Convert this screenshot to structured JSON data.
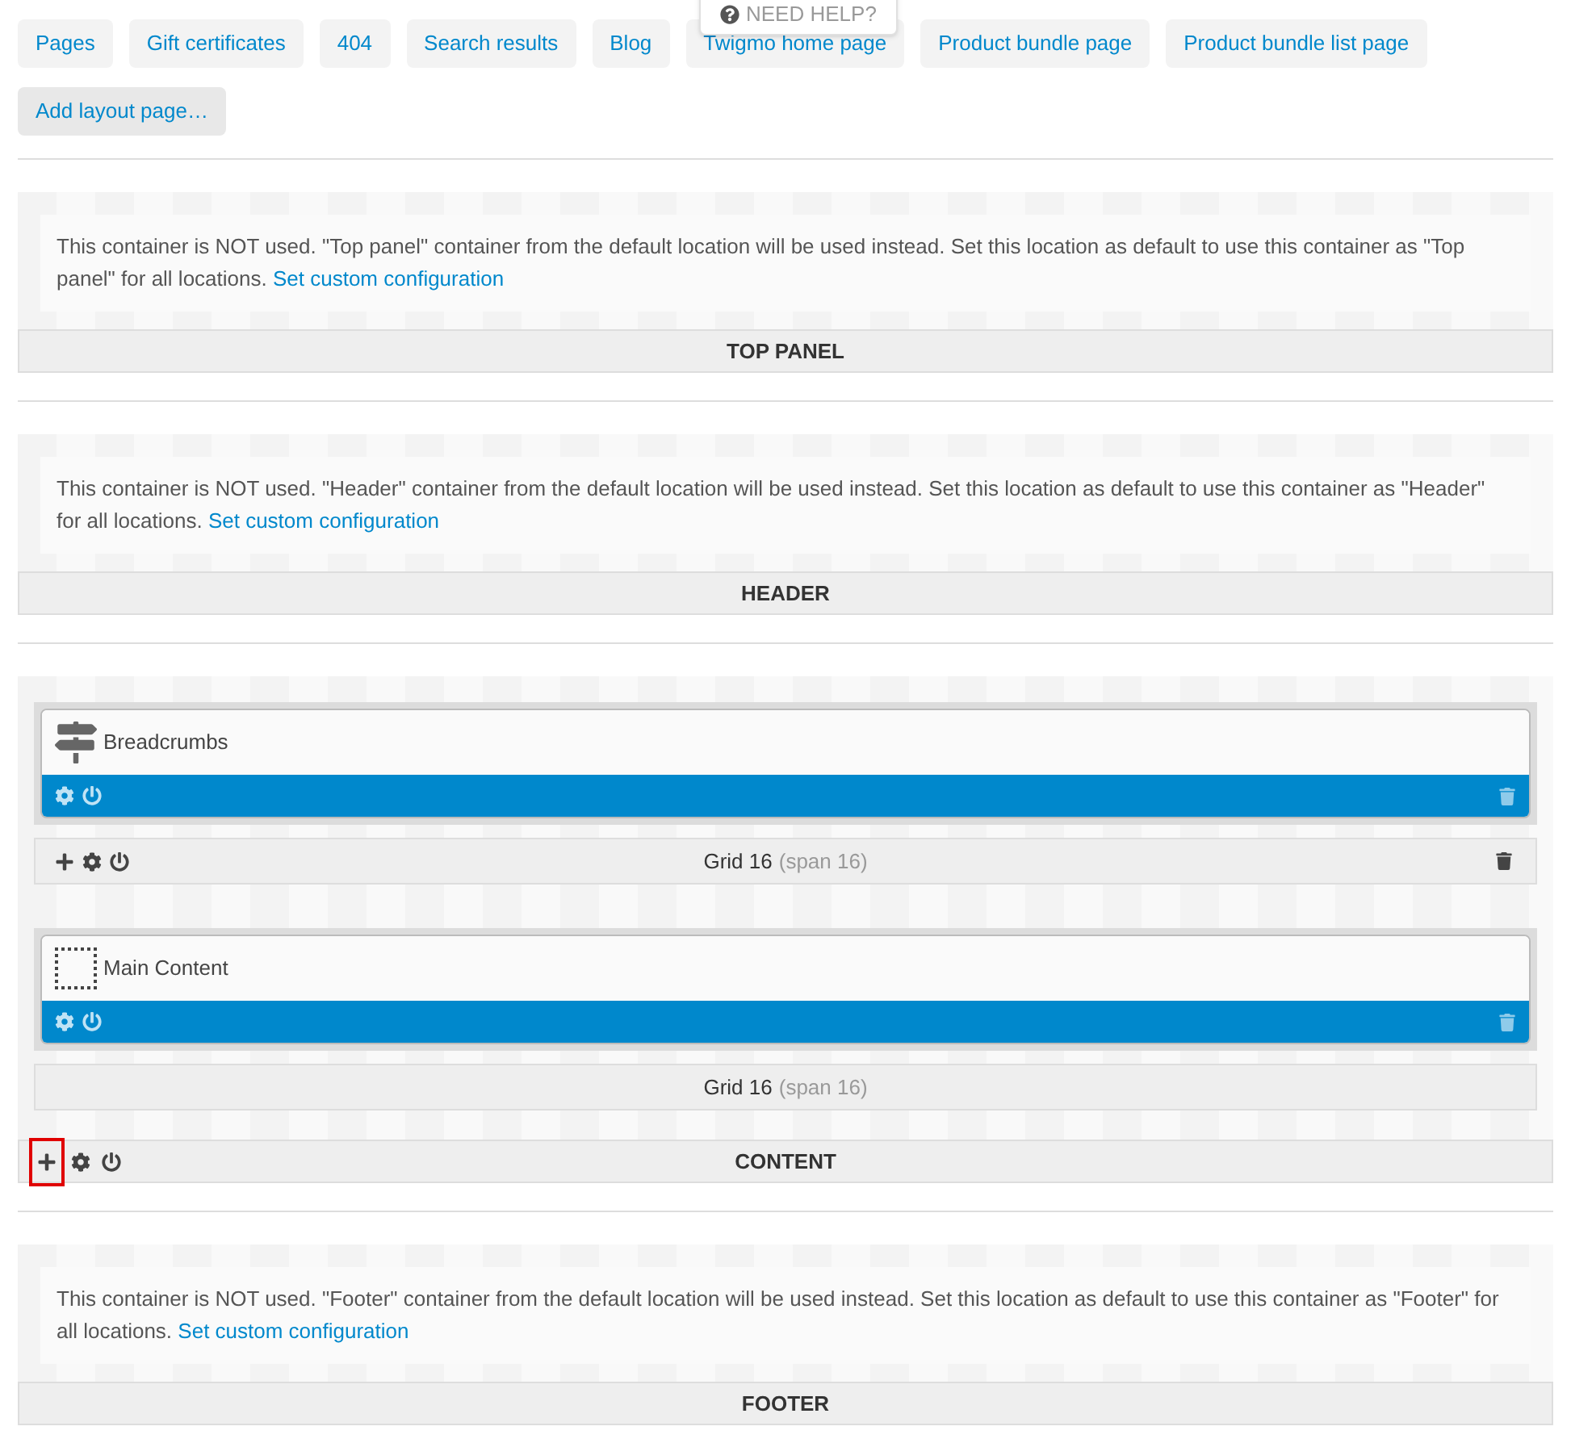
{
  "layout_tabs": [
    {
      "label": "Pages"
    },
    {
      "label": "Gift certificates"
    },
    {
      "label": "404"
    },
    {
      "label": "Search results"
    },
    {
      "label": "Blog"
    },
    {
      "label": "Twigmo home page"
    },
    {
      "label": "Product bundle page"
    },
    {
      "label": "Product bundle list page"
    }
  ],
  "help_tab": {
    "label": "NEED HELP?"
  },
  "add_layout_button": "Add layout page…",
  "containers": [
    {
      "kind": "unused",
      "notice": "This container is NOT used. \"Top panel\" container from the default location will be used instead. Set this location as default to use this container as \"Top panel\" for all locations.",
      "link": "Set custom configuration",
      "title": "TOP PANEL"
    },
    {
      "kind": "unused",
      "notice": "This container is NOT used. \"Header\" container from the default location will be used instead. Set this location as default to use this container as \"Header\" for all locations.",
      "link": "Set custom configuration",
      "title": "HEADER"
    },
    {
      "kind": "used",
      "title": "CONTENT",
      "add_highlighted": true,
      "grids": [
        {
          "title": "Grid 16",
          "span": "(span 16)",
          "actions": true,
          "block": {
            "name": "Breadcrumbs",
            "kind": "signpost"
          }
        },
        {
          "title": "Grid 16",
          "span": "(span 16)",
          "actions": false,
          "block": {
            "name": "Main Content",
            "kind": "placeholder"
          }
        }
      ]
    },
    {
      "kind": "unused",
      "notice": "This container is NOT used. \"Footer\" container from the default location will be used instead. Set this location as default to use this container as \"Footer\" for all locations.",
      "link": "Set custom configuration",
      "title": "FOOTER"
    }
  ]
}
